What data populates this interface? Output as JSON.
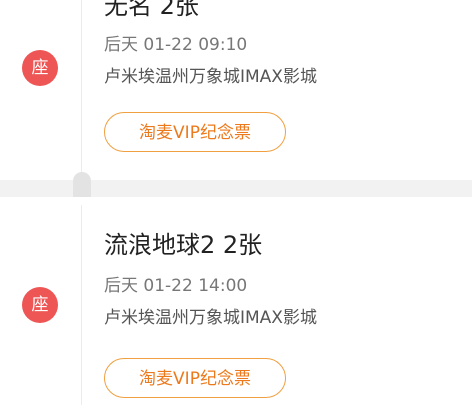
{
  "orders": [
    {
      "seat_badge": "座",
      "title": "无名 2张",
      "show_time": "后天 01-22 09:10",
      "cinema": "卢米埃温州万象城IMAX影城",
      "action_label": "淘麦VIP纪念票"
    },
    {
      "seat_badge": "座",
      "title": "流浪地球2 2张",
      "show_time": "后天 01-22 14:00",
      "cinema": "卢米埃温州万象城IMAX影城",
      "action_label": "淘麦VIP纪念票"
    }
  ],
  "colors": {
    "badge": "#ee5555",
    "accent": "#ec7a1d",
    "accent_border": "#f0a040"
  },
  "icons": {
    "seat_badge": "seat-badge-icon"
  }
}
